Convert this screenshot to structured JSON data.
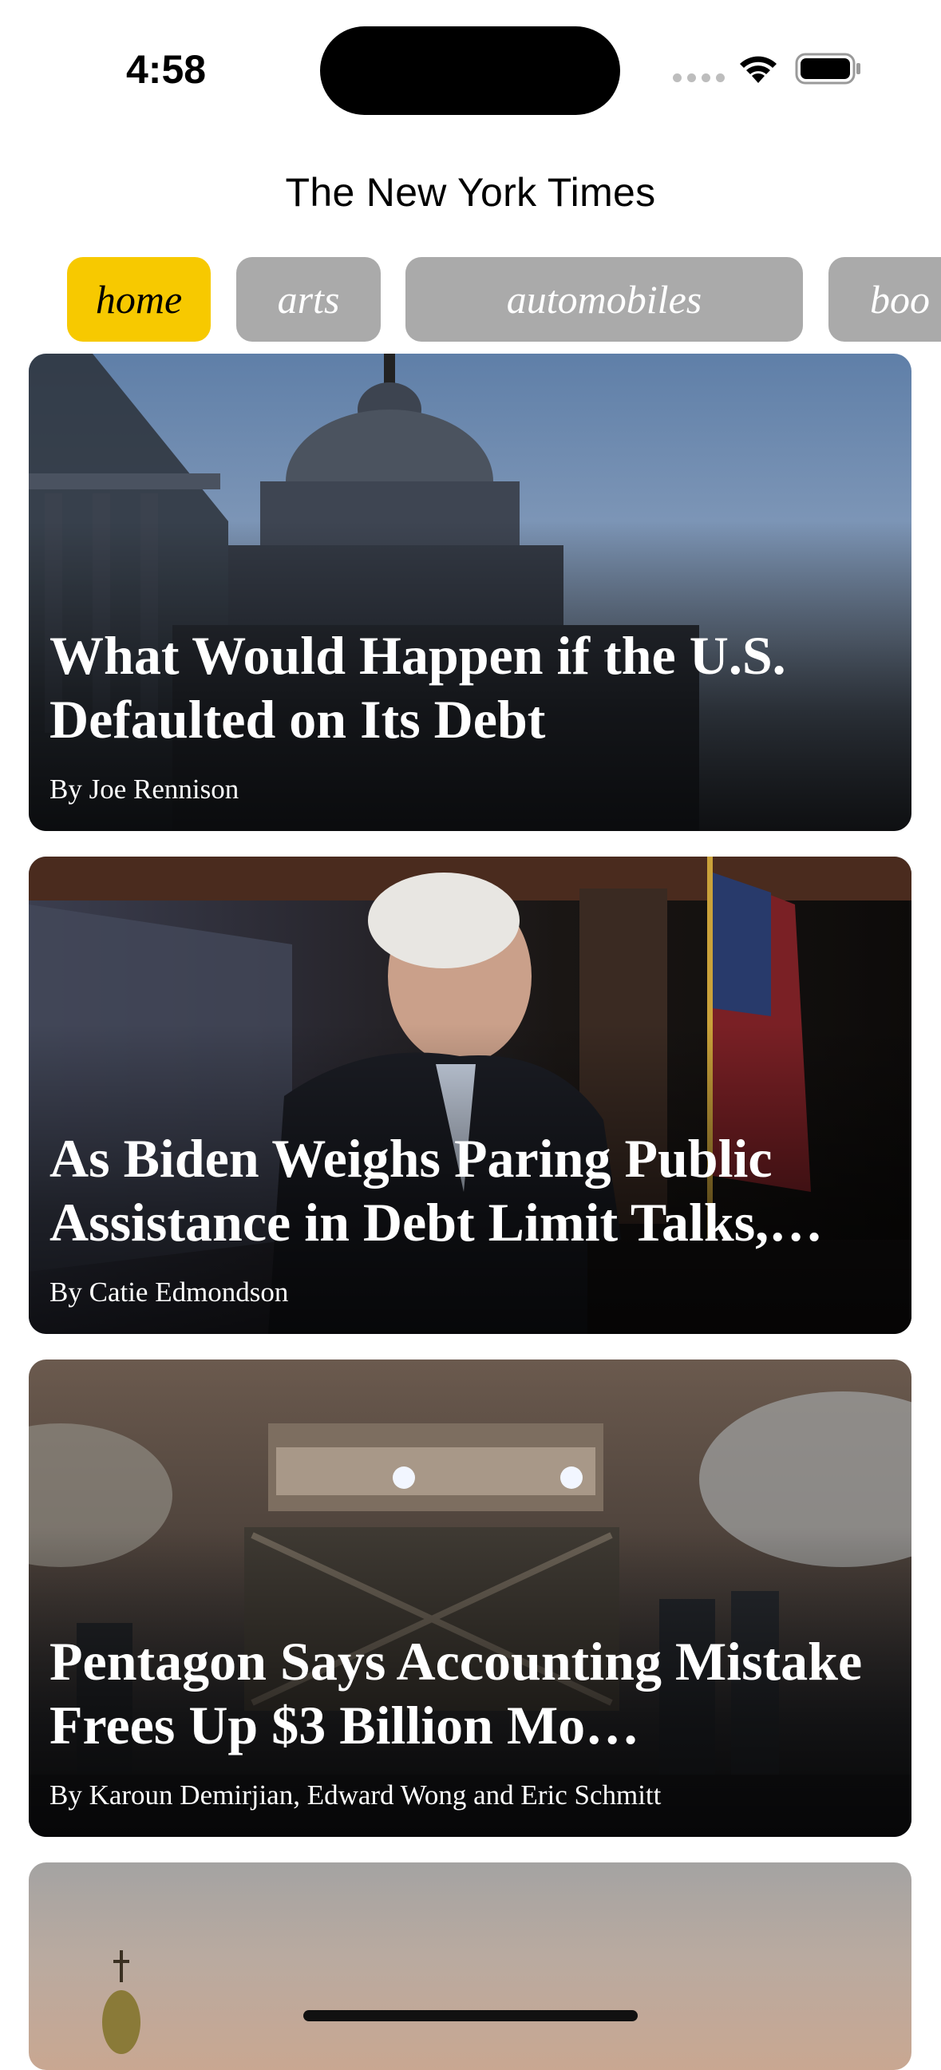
{
  "status": {
    "time": "4:58"
  },
  "app": {
    "title": "The New York Times"
  },
  "sections": [
    {
      "label": "home",
      "active": true
    },
    {
      "label": "arts",
      "active": false
    },
    {
      "label": "automobiles",
      "active": false
    },
    {
      "label": "boo",
      "active": false
    }
  ],
  "articles": [
    {
      "headline": "What Would Happen if the U.S. Defaulted on Its Debt",
      "byline": "By Joe Rennison"
    },
    {
      "headline": "As Biden Weighs Paring Public Assistance in Debt Limit Talks,…",
      "byline": "By Catie Edmondson"
    },
    {
      "headline": "Pentagon Says Accounting Mistake Frees Up $3 Billion Mo…",
      "byline": "By Karoun Demirjian, Edward Wong and Eric Schmitt"
    }
  ],
  "colors": {
    "active_pill": "#f7c900",
    "inactive_pill": "#aaaaaa"
  },
  "icons": [
    "cellular-signal-icon",
    "wifi-icon",
    "battery-icon"
  ]
}
